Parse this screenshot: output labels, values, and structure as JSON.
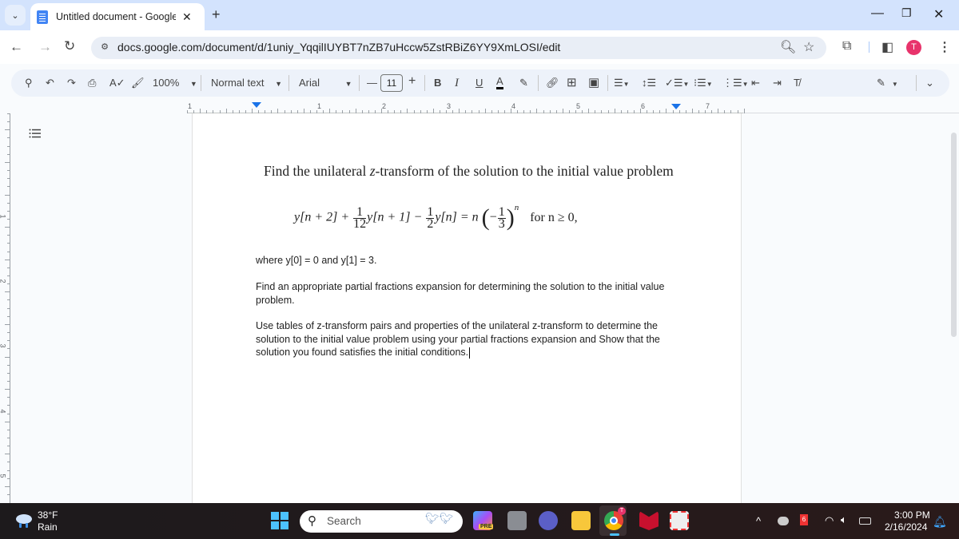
{
  "browser": {
    "tab_title": "Untitled document - Google Do",
    "tab_close": "✕",
    "new_tab": "+",
    "url": "docs.google.com/document/d/1uniy_YqqilIUYBT7nZB7uHccw5ZstRBiZ6YY9XmLOSI/edit",
    "profile_initial": "T",
    "profile_color": "#e8336b",
    "window_controls": [
      "—",
      "❐",
      "✕"
    ]
  },
  "docs_toolbar": {
    "zoom": "100%",
    "paragraph_style": "Normal text",
    "font": "Arial",
    "font_size": "11",
    "decrease": "—",
    "increase": "+",
    "bold": "B",
    "italic": "I",
    "underline": "U",
    "text_color": "A"
  },
  "ruler": {
    "horizontal_labels": [
      "1",
      "1",
      "2",
      "3",
      "4",
      "5",
      "6",
      "7"
    ],
    "vertical_labels": [
      "1",
      "2",
      "3",
      "4",
      "5"
    ]
  },
  "document": {
    "intro": "Find the unilateral z-transform of the solution to the initial value problem",
    "intro_parts": {
      "before": "Find the unilateral ",
      "var": "z",
      "after": "-transform of the solution to the initial value problem"
    },
    "equation": {
      "term1": "y[n + 2] +",
      "frac1_num": "1",
      "frac1_den": "12",
      "term2": "y[n + 1] −",
      "frac2_num": "1",
      "frac2_den": "2",
      "term3": "y[n] = n",
      "frac3_num": "1",
      "frac3_den": "3",
      "neg": "−",
      "exponent": "n",
      "condition": "for n ≥ 0,"
    },
    "initial_conditions": "where y[0] = 0 and y[1] = 3.",
    "paragraph2": "Find an appropriate partial fractions expansion for determining the solution to the initial value problem.",
    "paragraph3": "Use tables of z-transform pairs and properties of the unilateral z-transform to determine the solution to the initial value problem using your partial fractions expansion and Show that the solution you found satisfies the initial conditions."
  },
  "taskbar": {
    "weather_temp": "38°F",
    "weather_cond": "Rain",
    "search_label": "Search",
    "copilot_badge": "PRE",
    "time": "3:00 PM",
    "date": "2/16/2024",
    "badge_count": "6"
  }
}
